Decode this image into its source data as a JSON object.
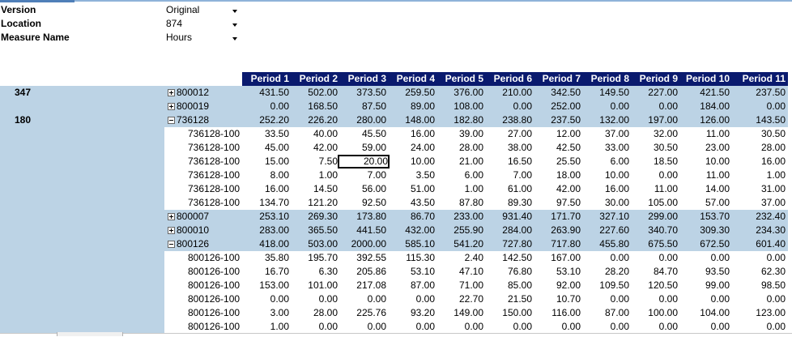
{
  "filters": [
    {
      "label": "Version",
      "value": "Original"
    },
    {
      "label": "Location",
      "value": "874"
    },
    {
      "label": "Measure Name",
      "value": "Hours"
    }
  ],
  "headers": [
    "Period 1",
    "Period 2",
    "Period 3",
    "Period 4",
    "Period 5",
    "Period 6",
    "Period 7",
    "Period 8",
    "Period 9",
    "Period 10",
    "Period 11"
  ],
  "groups": [
    {
      "label": "347",
      "row_index": 0
    },
    {
      "label": "180",
      "row_index": 2
    }
  ],
  "rows": [
    {
      "label": "800012",
      "kind": "collapsed",
      "values": [
        "431.50",
        "502.00",
        "373.50",
        "259.50",
        "376.00",
        "210.00",
        "342.50",
        "149.50",
        "227.00",
        "421.50",
        "237.50"
      ]
    },
    {
      "label": "800019",
      "kind": "collapsed",
      "values": [
        "0.00",
        "168.50",
        "87.50",
        "89.00",
        "108.00",
        "0.00",
        "252.00",
        "0.00",
        "0.00",
        "184.00",
        "0.00"
      ]
    },
    {
      "label": "736128",
      "kind": "expanded",
      "values": [
        "252.20",
        "226.20",
        "280.00",
        "148.00",
        "182.80",
        "238.80",
        "237.50",
        "132.00",
        "197.00",
        "126.00",
        "143.50"
      ]
    },
    {
      "label": "736128-100",
      "kind": "child",
      "values": [
        "33.50",
        "40.00",
        "45.50",
        "16.00",
        "39.00",
        "27.00",
        "12.00",
        "37.00",
        "32.00",
        "11.00",
        "30.50"
      ]
    },
    {
      "label": "736128-100",
      "kind": "child",
      "values": [
        "45.00",
        "42.00",
        "59.00",
        "24.00",
        "28.00",
        "38.00",
        "42.50",
        "33.00",
        "30.50",
        "23.00",
        "28.00"
      ]
    },
    {
      "label": "736128-100",
      "kind": "child",
      "values": [
        "15.00",
        "7.50",
        "20.00",
        "10.00",
        "21.00",
        "16.50",
        "25.50",
        "6.00",
        "18.50",
        "10.00",
        "16.00"
      ]
    },
    {
      "label": "736128-100",
      "kind": "child",
      "values": [
        "8.00",
        "1.00",
        "7.00",
        "3.50",
        "6.00",
        "7.00",
        "18.00",
        "10.00",
        "0.00",
        "11.00",
        "1.00"
      ]
    },
    {
      "label": "736128-100",
      "kind": "child",
      "values": [
        "16.00",
        "14.50",
        "56.00",
        "51.00",
        "1.00",
        "61.00",
        "42.00",
        "16.00",
        "11.00",
        "14.00",
        "31.00"
      ]
    },
    {
      "label": "736128-100",
      "kind": "child",
      "values": [
        "134.70",
        "121.20",
        "92.50",
        "43.50",
        "87.80",
        "89.30",
        "97.50",
        "30.00",
        "105.00",
        "57.00",
        "37.00"
      ]
    },
    {
      "label": "800007",
      "kind": "collapsed",
      "values": [
        "253.10",
        "269.30",
        "173.80",
        "86.70",
        "233.00",
        "931.40",
        "171.70",
        "327.10",
        "299.00",
        "153.70",
        "232.40"
      ]
    },
    {
      "label": "800010",
      "kind": "collapsed",
      "values": [
        "283.00",
        "365.50",
        "441.50",
        "432.00",
        "255.90",
        "284.00",
        "263.90",
        "227.60",
        "340.70",
        "309.30",
        "234.30"
      ]
    },
    {
      "label": "800126",
      "kind": "expanded",
      "values": [
        "418.00",
        "503.00",
        "2000.00",
        "585.10",
        "541.20",
        "727.80",
        "717.80",
        "455.80",
        "675.50",
        "672.50",
        "601.40"
      ]
    },
    {
      "label": "800126-100",
      "kind": "child",
      "values": [
        "35.80",
        "195.70",
        "392.55",
        "115.30",
        "2.40",
        "142.50",
        "167.00",
        "0.00",
        "0.00",
        "0.00",
        "0.00"
      ]
    },
    {
      "label": "800126-100",
      "kind": "child",
      "values": [
        "16.70",
        "6.30",
        "205.86",
        "53.10",
        "47.10",
        "76.80",
        "53.10",
        "28.20",
        "84.70",
        "93.50",
        "62.30"
      ]
    },
    {
      "label": "800126-100",
      "kind": "child",
      "values": [
        "153.00",
        "101.00",
        "217.08",
        "87.00",
        "71.00",
        "85.00",
        "92.00",
        "109.50",
        "120.50",
        "99.00",
        "98.50"
      ]
    },
    {
      "label": "800126-100",
      "kind": "child",
      "values": [
        "0.00",
        "0.00",
        "0.00",
        "0.00",
        "22.70",
        "21.50",
        "10.70",
        "0.00",
        "0.00",
        "0.00",
        "0.00"
      ]
    },
    {
      "label": "800126-100",
      "kind": "child",
      "values": [
        "3.00",
        "28.00",
        "225.76",
        "93.20",
        "149.00",
        "150.00",
        "116.00",
        "87.00",
        "100.00",
        "104.00",
        "123.00"
      ]
    },
    {
      "label": "800126-100",
      "kind": "child",
      "values": [
        "1.00",
        "0.00",
        "0.00",
        "0.00",
        "0.00",
        "0.00",
        "0.00",
        "0.00",
        "0.00",
        "0.00",
        "0.00"
      ]
    }
  ],
  "selected_cell": {
    "row": 5,
    "col": 2
  },
  "colors": {
    "header_bg": "#0a1a6e",
    "band_bg": "#bcd3e5"
  }
}
